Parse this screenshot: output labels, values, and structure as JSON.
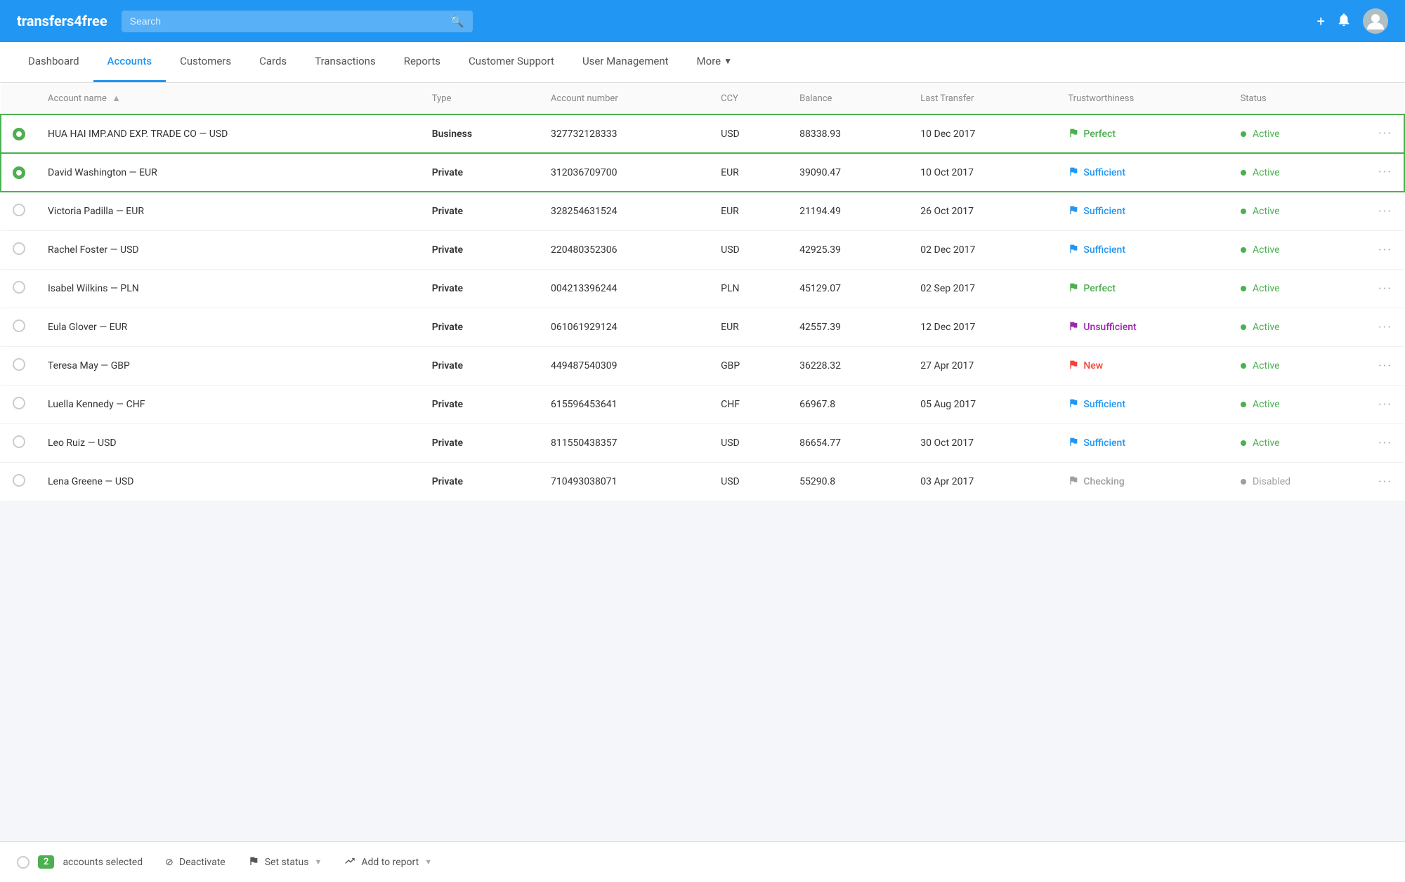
{
  "header": {
    "logo": "transfers4free",
    "search_placeholder": "Search",
    "add_icon": "+",
    "notification_icon": "🔔"
  },
  "nav": {
    "items": [
      {
        "label": "Dashboard",
        "active": false
      },
      {
        "label": "Accounts",
        "active": true
      },
      {
        "label": "Customers",
        "active": false
      },
      {
        "label": "Cards",
        "active": false
      },
      {
        "label": "Transactions",
        "active": false
      },
      {
        "label": "Reports",
        "active": false
      },
      {
        "label": "Customer Support",
        "active": false
      },
      {
        "label": "User Management",
        "active": false
      },
      {
        "label": "More",
        "active": false,
        "dropdown": true
      }
    ]
  },
  "table": {
    "columns": [
      "Account name",
      "Type",
      "Account number",
      "CCY",
      "Balance",
      "Last Transfer",
      "Trustworthiness",
      "Status"
    ],
    "rows": [
      {
        "id": 1,
        "selected": true,
        "name": "HUA HAI IMP.AND EXP. TRADE CO — USD",
        "type": "Business",
        "account": "327732128333",
        "ccy": "USD",
        "balance": "88338.93",
        "lastTransfer": "10 Dec 2017",
        "trustFlag": "green",
        "trust": "Perfect",
        "statusDot": "active",
        "status": "Active"
      },
      {
        "id": 2,
        "selected": true,
        "name": "David Washington — EUR",
        "type": "Private",
        "account": "312036709700",
        "ccy": "EUR",
        "balance": "39090.47",
        "lastTransfer": "10 Oct 2017",
        "trustFlag": "blue",
        "trust": "Sufficient",
        "statusDot": "active",
        "status": "Active"
      },
      {
        "id": 3,
        "selected": false,
        "name": "Victoria Padilla — EUR",
        "type": "Private",
        "account": "328254631524",
        "ccy": "EUR",
        "balance": "21194.49",
        "lastTransfer": "26 Oct 2017",
        "trustFlag": "blue",
        "trust": "Sufficient",
        "statusDot": "active",
        "status": "Active"
      },
      {
        "id": 4,
        "selected": false,
        "name": "Rachel Foster — USD",
        "type": "Private",
        "account": "220480352306",
        "ccy": "USD",
        "balance": "42925.39",
        "lastTransfer": "02 Dec 2017",
        "trustFlag": "blue",
        "trust": "Sufficient",
        "statusDot": "active",
        "status": "Active"
      },
      {
        "id": 5,
        "selected": false,
        "name": "Isabel Wilkins — PLN",
        "type": "Private",
        "account": "004213396244",
        "ccy": "PLN",
        "balance": "45129.07",
        "lastTransfer": "02 Sep 2017",
        "trustFlag": "green",
        "trust": "Perfect",
        "statusDot": "active",
        "status": "Active"
      },
      {
        "id": 6,
        "selected": false,
        "name": "Eula Glover — EUR",
        "type": "Private",
        "account": "061061929124",
        "ccy": "EUR",
        "balance": "42557.39",
        "lastTransfer": "12 Dec 2017",
        "trustFlag": "purple",
        "trust": "Unsufficient",
        "statusDot": "active",
        "status": "Active"
      },
      {
        "id": 7,
        "selected": false,
        "name": "Teresa May — GBP",
        "type": "Private",
        "account": "449487540309",
        "ccy": "GBP",
        "balance": "36228.32",
        "lastTransfer": "27 Apr 2017",
        "trustFlag": "red",
        "trust": "New",
        "statusDot": "active",
        "status": "Active"
      },
      {
        "id": 8,
        "selected": false,
        "name": "Luella Kennedy — CHF",
        "type": "Private",
        "account": "615596453641",
        "ccy": "CHF",
        "balance": "66967.8",
        "lastTransfer": "05 Aug 2017",
        "trustFlag": "blue",
        "trust": "Sufficient",
        "statusDot": "active",
        "status": "Active"
      },
      {
        "id": 9,
        "selected": false,
        "name": "Leo Ruiz — USD",
        "type": "Private",
        "account": "811550438357",
        "ccy": "USD",
        "balance": "86654.77",
        "lastTransfer": "30 Oct 2017",
        "trustFlag": "blue",
        "trust": "Sufficient",
        "statusDot": "active",
        "status": "Active"
      },
      {
        "id": 10,
        "selected": false,
        "name": "Lena Greene — USD",
        "type": "Private",
        "account": "710493038071",
        "ccy": "USD",
        "balance": "55290.8",
        "lastTransfer": "03 Apr 2017",
        "trustFlag": "gray",
        "trust": "Checking",
        "statusDot": "disabled",
        "status": "Disabled"
      }
    ]
  },
  "bottomBar": {
    "count": "2",
    "countLabel": "accounts selected",
    "deactivate": "Deactivate",
    "setStatus": "Set status",
    "addToReport": "Add to report"
  }
}
